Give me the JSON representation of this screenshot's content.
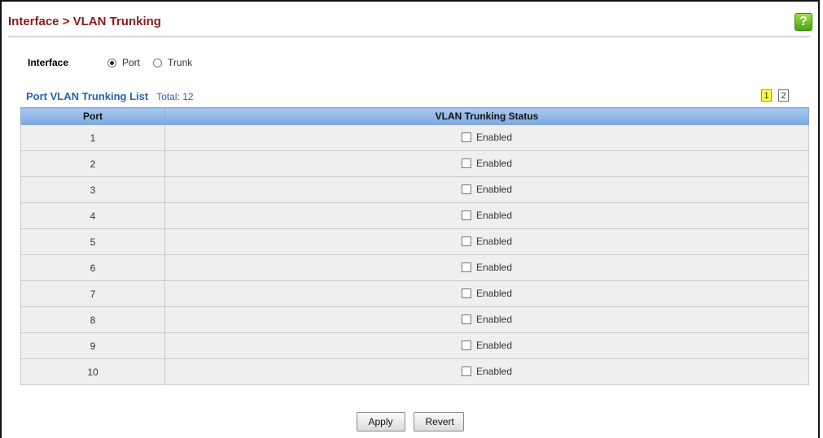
{
  "header": {
    "title": "Interface > VLAN Trunking",
    "help_icon": "help-icon"
  },
  "interface": {
    "label": "Interface",
    "options": [
      {
        "label": "Port",
        "selected": true
      },
      {
        "label": "Trunk",
        "selected": false
      }
    ]
  },
  "list": {
    "title": "Port VLAN Trunking List",
    "total": "Total: 12",
    "pages": [
      "1",
      "2"
    ],
    "active_page": "1"
  },
  "table": {
    "columns": [
      "Port",
      "VLAN Trunking Status"
    ],
    "rows": [
      {
        "port": "1",
        "status_label": "Enabled",
        "checked": false
      },
      {
        "port": "2",
        "status_label": "Enabled",
        "checked": false
      },
      {
        "port": "3",
        "status_label": "Enabled",
        "checked": false
      },
      {
        "port": "4",
        "status_label": "Enabled",
        "checked": false
      },
      {
        "port": "5",
        "status_label": "Enabled",
        "checked": false
      },
      {
        "port": "6",
        "status_label": "Enabled",
        "checked": false
      },
      {
        "port": "7",
        "status_label": "Enabled",
        "checked": false
      },
      {
        "port": "8",
        "status_label": "Enabled",
        "checked": false
      },
      {
        "port": "9",
        "status_label": "Enabled",
        "checked": false
      },
      {
        "port": "10",
        "status_label": "Enabled",
        "checked": false
      }
    ]
  },
  "buttons": {
    "apply": "Apply",
    "revert": "Revert"
  },
  "colors": {
    "title": "#8b1a1a",
    "list_title": "#2a62b0",
    "header_row": "#7ea8e0",
    "active_page": "#ffff3c",
    "help_icon": "#4aa312"
  }
}
